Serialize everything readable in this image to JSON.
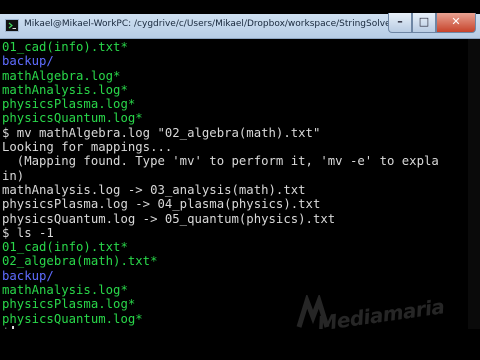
{
  "window": {
    "title": "Mikael@Mikael-WorkPC: /cygdrive/c/Users/Mikael/Dropbox/workspace/StringSolver/res/rename",
    "controls": {
      "minimize": "–",
      "maximize": "□",
      "close": "✕"
    },
    "icon": "terminal-icon"
  },
  "terminal": {
    "colors": {
      "green": "#29d84a",
      "blue": "#5f6cff",
      "white": "#d9d9d9"
    },
    "lines": [
      {
        "text": "01_cad(info).txt*",
        "color": "green"
      },
      {
        "text": "backup/",
        "color": "blue"
      },
      {
        "text": "mathAlgebra.log*",
        "color": "green"
      },
      {
        "text": "mathAnalysis.log*",
        "color": "green"
      },
      {
        "text": "physicsPlasma.log*",
        "color": "green"
      },
      {
        "text": "physicsQuantum.log*",
        "color": "green"
      },
      {
        "text": "$ mv mathAlgebra.log \"02_algebra(math).txt\"",
        "color": "white"
      },
      {
        "text": "Looking for mappings...",
        "color": "white"
      },
      {
        "text": "  (Mapping found. Type 'mv' to perform it, 'mv -e' to expla",
        "color": "white"
      },
      {
        "text": "in)",
        "color": "white"
      },
      {
        "text": "mathAnalysis.log -> 03_analysis(math).txt",
        "color": "white"
      },
      {
        "text": "physicsPlasma.log -> 04_plasma(physics).txt",
        "color": "white"
      },
      {
        "text": "physicsQuantum.log -> 05_quantum(physics).txt",
        "color": "white"
      },
      {
        "text": "$ ls -1",
        "color": "white"
      },
      {
        "text": "01_cad(info).txt*",
        "color": "green"
      },
      {
        "text": "02_algebra(math).txt*",
        "color": "green"
      },
      {
        "text": "backup/",
        "color": "blue"
      },
      {
        "text": "mathAnalysis.log*",
        "color": "green"
      },
      {
        "text": "physicsPlasma.log*",
        "color": "green"
      },
      {
        "text": "physicsQuantum.log*",
        "color": "green"
      },
      {
        "text": "$",
        "color": "white",
        "cursor": true
      }
    ]
  },
  "watermark": {
    "text": "Mediamaria"
  }
}
